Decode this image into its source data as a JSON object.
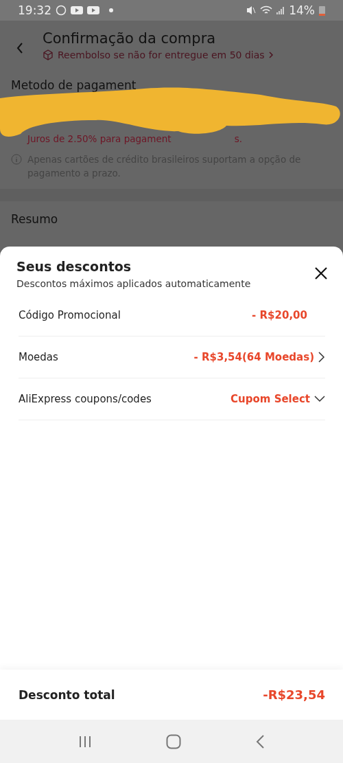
{
  "status_bar": {
    "time": "19:32",
    "battery": "14%"
  },
  "header": {
    "title": "Confirmação da compra",
    "subtitle": "Reembolso se não for entregue em 50 dias"
  },
  "background": {
    "payment_title": "Metodo de pagament",
    "fee_note": [
      "Juros de 2.50% para pagament",
      "s."
    ],
    "info": "Apenas cartões de crédito brasileiros suportam a opção de pagamento a prazo.",
    "summary_title": "Resumo"
  },
  "sheet": {
    "title": "Seus descontos",
    "subtitle": "Descontos máximos aplicados automaticamente",
    "rows": [
      {
        "label": "Código Promocional",
        "value": "- R$20,00",
        "kind": "plain"
      },
      {
        "label": "Moedas",
        "value": "- R$3,54(64 Moedas)",
        "kind": "link"
      },
      {
        "label": "AliExpress coupons/codes",
        "value": "Cupom Select",
        "kind": "dropdown"
      }
    ],
    "total": {
      "label": "Desconto total",
      "value": "-R$23,54"
    }
  }
}
